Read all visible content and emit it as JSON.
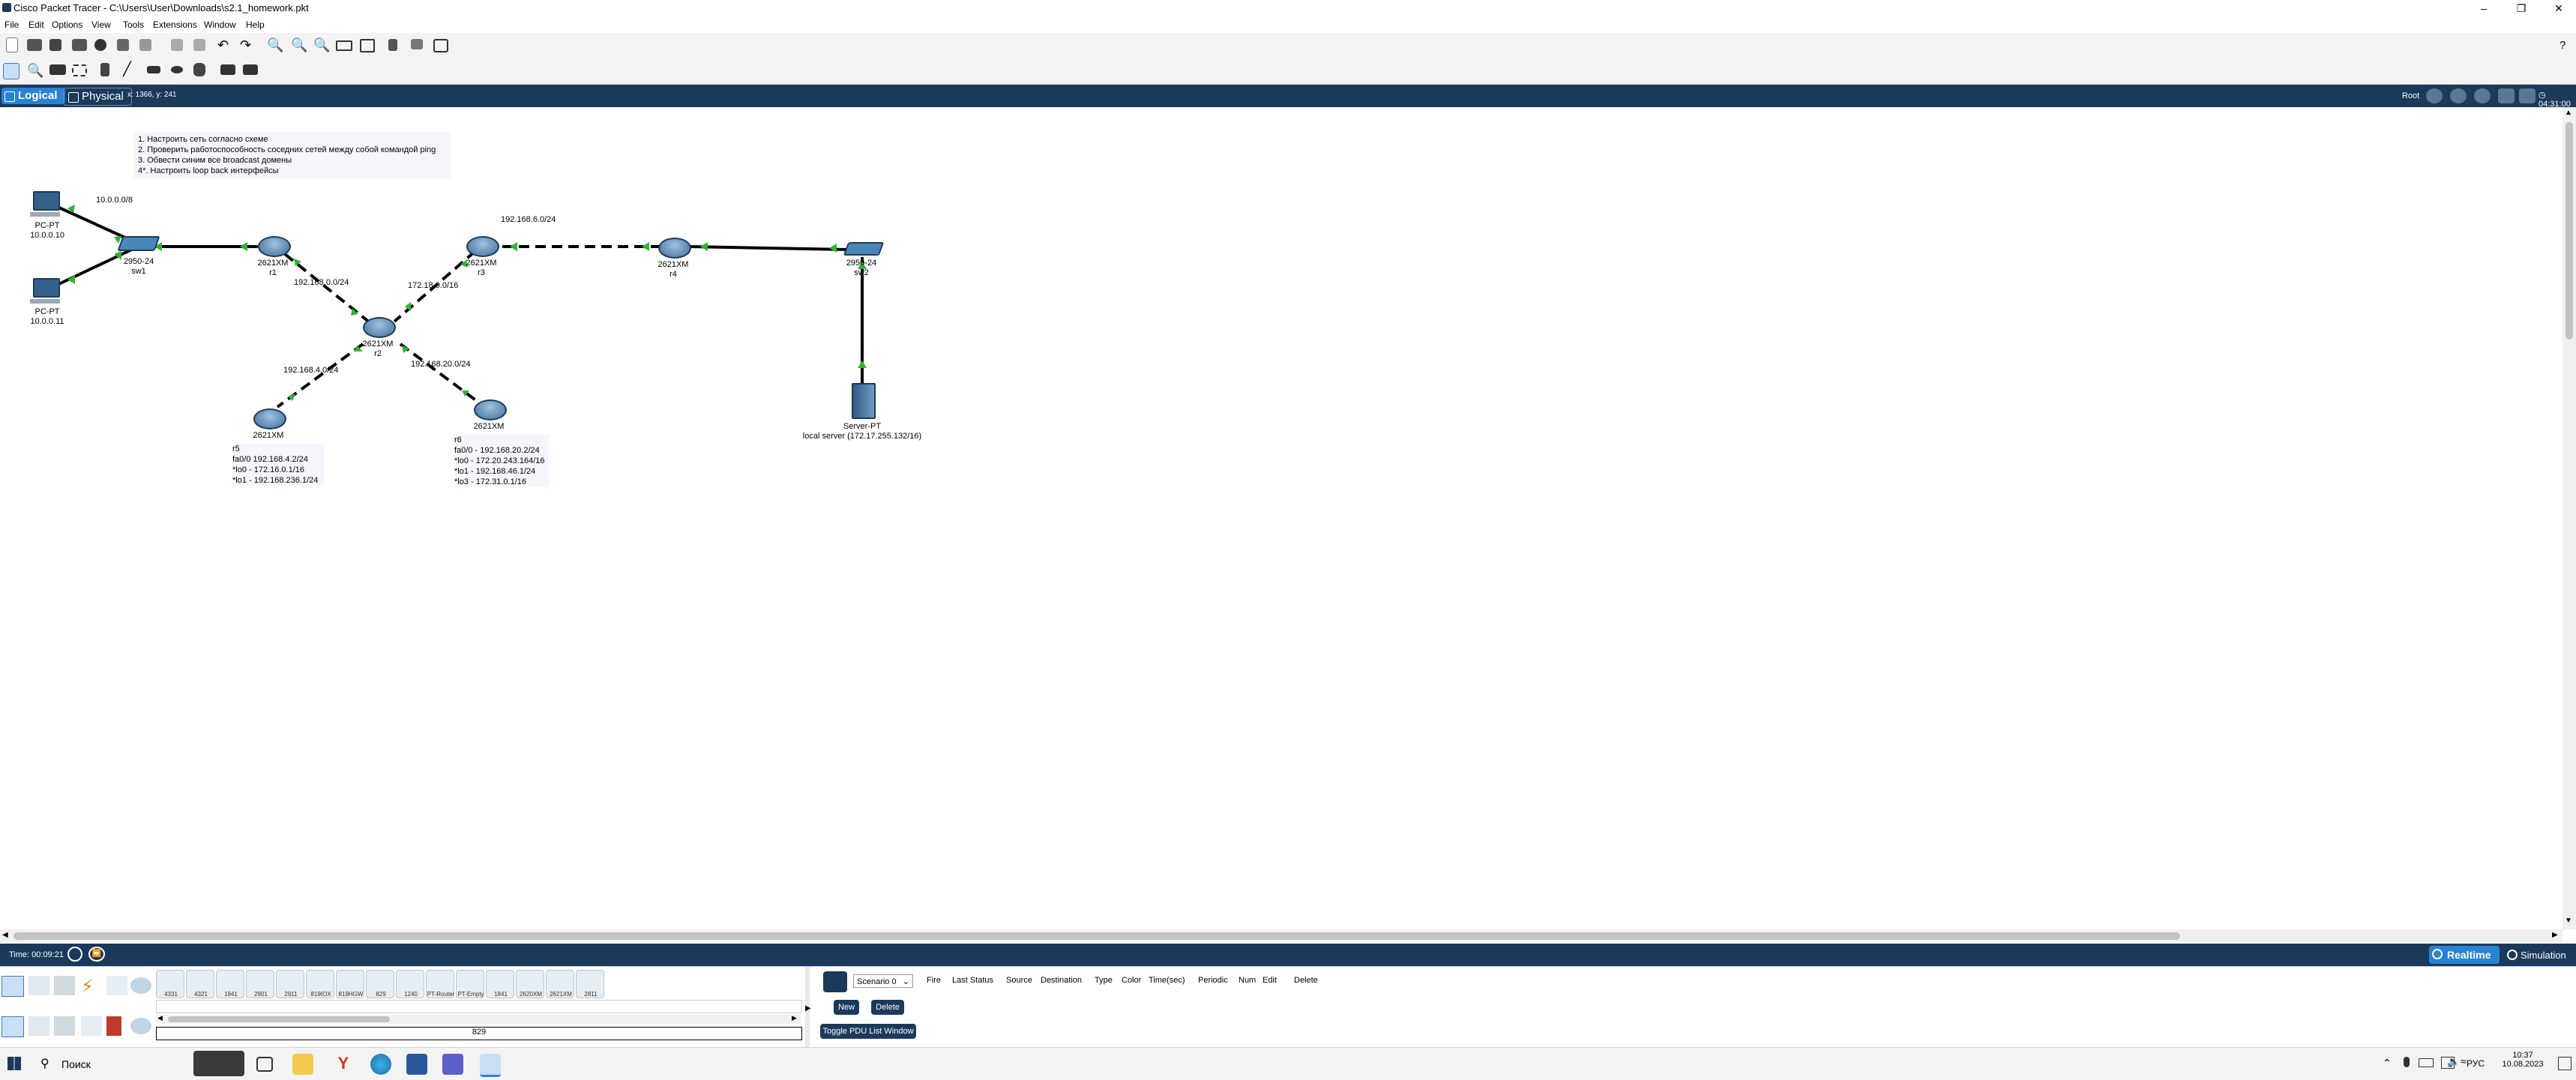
{
  "window": {
    "title": "Cisco Packet Tracer - C:\\Users\\User\\Downloads\\s2.1_homework.pkt",
    "help": "?"
  },
  "menu": [
    "File",
    "Edit",
    "Options",
    "View",
    "Tools",
    "Extensions",
    "Window",
    "Help"
  ],
  "viewbar": {
    "logical": "Logical",
    "physical": "Physical",
    "coords": "x: 1366, y: 241",
    "root": "Root",
    "clock": "04:31:00"
  },
  "notes": {
    "tasks": [
      "1. Настроить сеть согласно схеме",
      "2. Проверить работоспособность соседних сетей между собой командой ping",
      "3. Обвести синим все broadcast домены",
      "4*. Настроить loop back интерфейсы"
    ]
  },
  "nodes": {
    "pc0": {
      "type": "PC-PT",
      "ip": "10.0.0.10"
    },
    "pc1": {
      "type": "PC-PT",
      "ip": "10.0.0.11"
    },
    "sw1": {
      "model": "2950-24",
      "name": "sw1"
    },
    "r1": {
      "model": "2621XM",
      "name": "r1"
    },
    "r2": {
      "model": "2621XM",
      "name": "r2"
    },
    "r3": {
      "model": "2621XM",
      "name": "r3"
    },
    "r4": {
      "model": "2621XM",
      "name": "r4"
    },
    "r5": {
      "model": "2621XM",
      "name": "r5",
      "info": [
        "fa0/0 192.168.4.2/24",
        "*lo0 - 172.16.0.1/16",
        "*lo1 - 192.168.236.1/24"
      ]
    },
    "r6": {
      "model": "2621XM",
      "name": "r6",
      "info": [
        "fa0/0 - 192.168.20.2/24",
        "*lo0 - 172.20.243.164/16",
        "*lo1 - 192.168.46.1/24",
        "*lo3 - 172.31.0.1/16"
      ]
    },
    "sw2": {
      "model": "2950-24",
      "name": "sw2"
    },
    "server": {
      "type": "Server-PT",
      "name": "local server (172.17.255.132/16)"
    }
  },
  "networks": {
    "n1": "10.0.0.0/8",
    "n2": "192.168.0.0/24",
    "n3": "172.18.0.0/16",
    "n4": "192.168.6.0/24",
    "n5": "192.168.4.0/24",
    "n6": "192.168.20.0/24"
  },
  "status": {
    "time": "Time: 00:09:21",
    "realtime": "Realtime",
    "simulation": "Simulation"
  },
  "bottom": {
    "devices": [
      "4331",
      "4321",
      "1941",
      "2901",
      "2911",
      "819IOX",
      "819HGW",
      "829",
      "1240",
      "PT-Router",
      "PT-Empty",
      "1841",
      "2620XM",
      "2621XM",
      "2811"
    ],
    "selected_label": "829",
    "scenario": "Scenario 0",
    "new": "New",
    "delete": "Delete",
    "toggle": "Toggle PDU List Window",
    "columns": [
      "Fire",
      "Last Status",
      "Source",
      "Destination",
      "Type",
      "Color",
      "Time(sec)",
      "Periodic",
      "Num",
      "Edit",
      "Delete"
    ]
  },
  "taskbar": {
    "search": "Поиск",
    "lang": "РУС",
    "time": "10:37",
    "date": "10.08.2023"
  },
  "colors": {
    "navy": "#1b3a5b",
    "link_up": "#2db52d",
    "realtime": "#2a82d4"
  }
}
